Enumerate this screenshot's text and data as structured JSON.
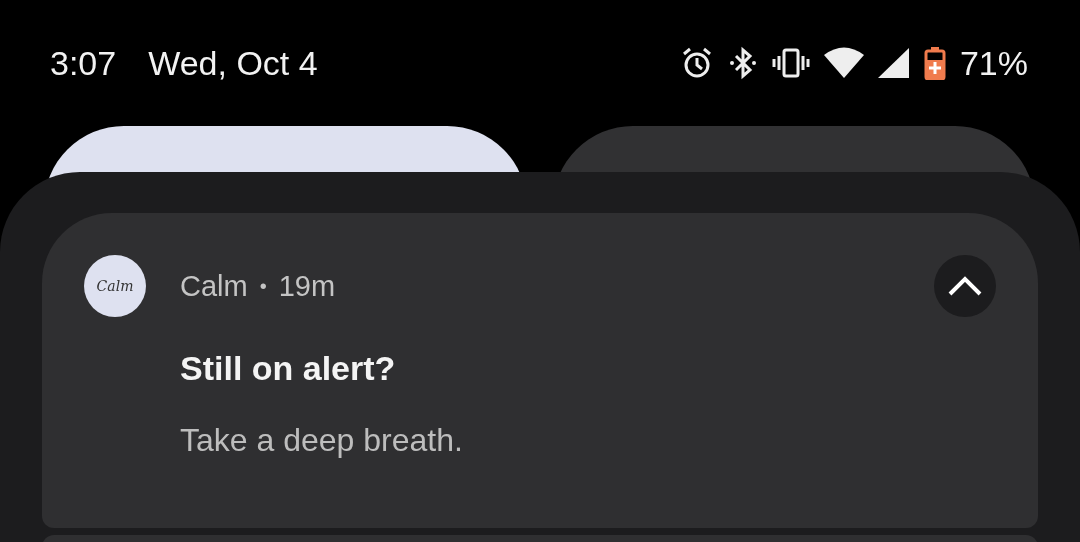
{
  "status_bar": {
    "time": "3:07",
    "date": "Wed, Oct 4",
    "battery": "71%"
  },
  "quick_tiles": [
    {
      "on": true
    },
    {
      "on": false
    }
  ],
  "notification": {
    "app_icon_text": "Calm",
    "app": "Calm",
    "separator": "•",
    "time": "19m",
    "expanded": true,
    "title": "Still on alert?",
    "body": "Take a deep breath."
  }
}
